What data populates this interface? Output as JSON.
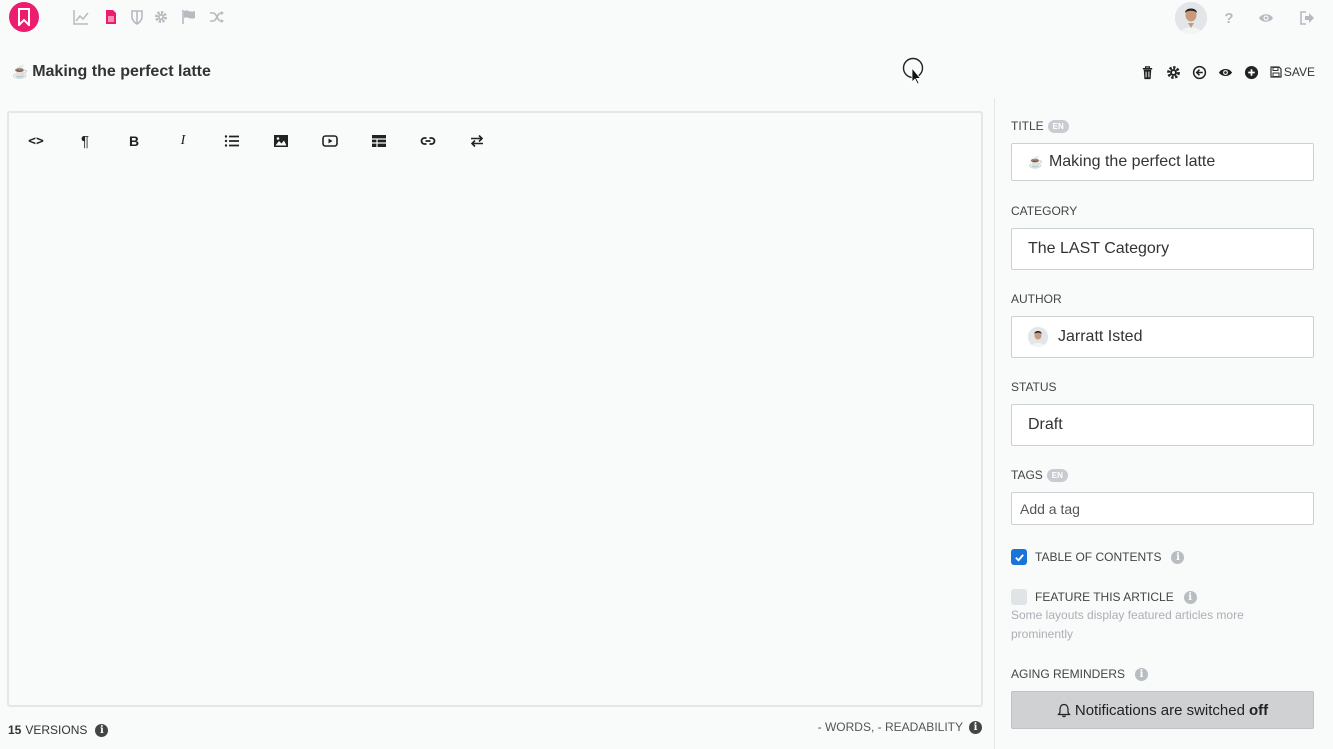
{
  "nav": {
    "logo": "logo",
    "icons": [
      "chart-icon",
      "document-icon",
      "shield-icon",
      "gear-icon",
      "flag-icon",
      "shuffle-icon"
    ],
    "right_icons": [
      "help-icon",
      "eye-icon",
      "logout-icon"
    ],
    "help_label": "?",
    "brand_color": "#ec1c6e"
  },
  "header": {
    "emoji": "☕",
    "title": "Making the perfect latte",
    "save_label": "SAVE"
  },
  "editor": {
    "toolbar": [
      {
        "name": "code-icon",
        "label": "<>"
      },
      {
        "name": "paragraph-icon",
        "label": "¶"
      },
      {
        "name": "bold-icon",
        "label": "B"
      },
      {
        "name": "italic-icon",
        "label": "I"
      },
      {
        "name": "list-icon",
        "label": ""
      },
      {
        "name": "image-icon",
        "label": ""
      },
      {
        "name": "video-icon",
        "label": ""
      },
      {
        "name": "table-icon",
        "label": ""
      },
      {
        "name": "link-icon",
        "label": ""
      },
      {
        "name": "swap-icon",
        "label": ""
      }
    ],
    "versions_count": "15",
    "versions_label": "VERSIONS",
    "stats": "- WORDS, - READABILITY"
  },
  "sidebar": {
    "title_label": "TITLE",
    "lang_badge": "EN",
    "title_emoji": "☕",
    "title_value": "Making the perfect latte",
    "category_label": "CATEGORY",
    "category_value": "The LAST Category",
    "author_label": "AUTHOR",
    "author_value": "Jarratt Isted",
    "status_label": "STATUS",
    "status_value": "Draft",
    "tags_label": "TAGS",
    "tags_placeholder": "Add a tag",
    "toc_label": "TABLE OF CONTENTS",
    "toc_checked": true,
    "feature_label": "FEATURE THIS ARTICLE",
    "feature_checked": false,
    "feature_help": "Some layouts display featured articles more prominently",
    "aging_label": "AGING REMINDERS",
    "notify_text": "Notifications are switched",
    "notify_state": "off",
    "accent_color": "#1a73d9"
  }
}
